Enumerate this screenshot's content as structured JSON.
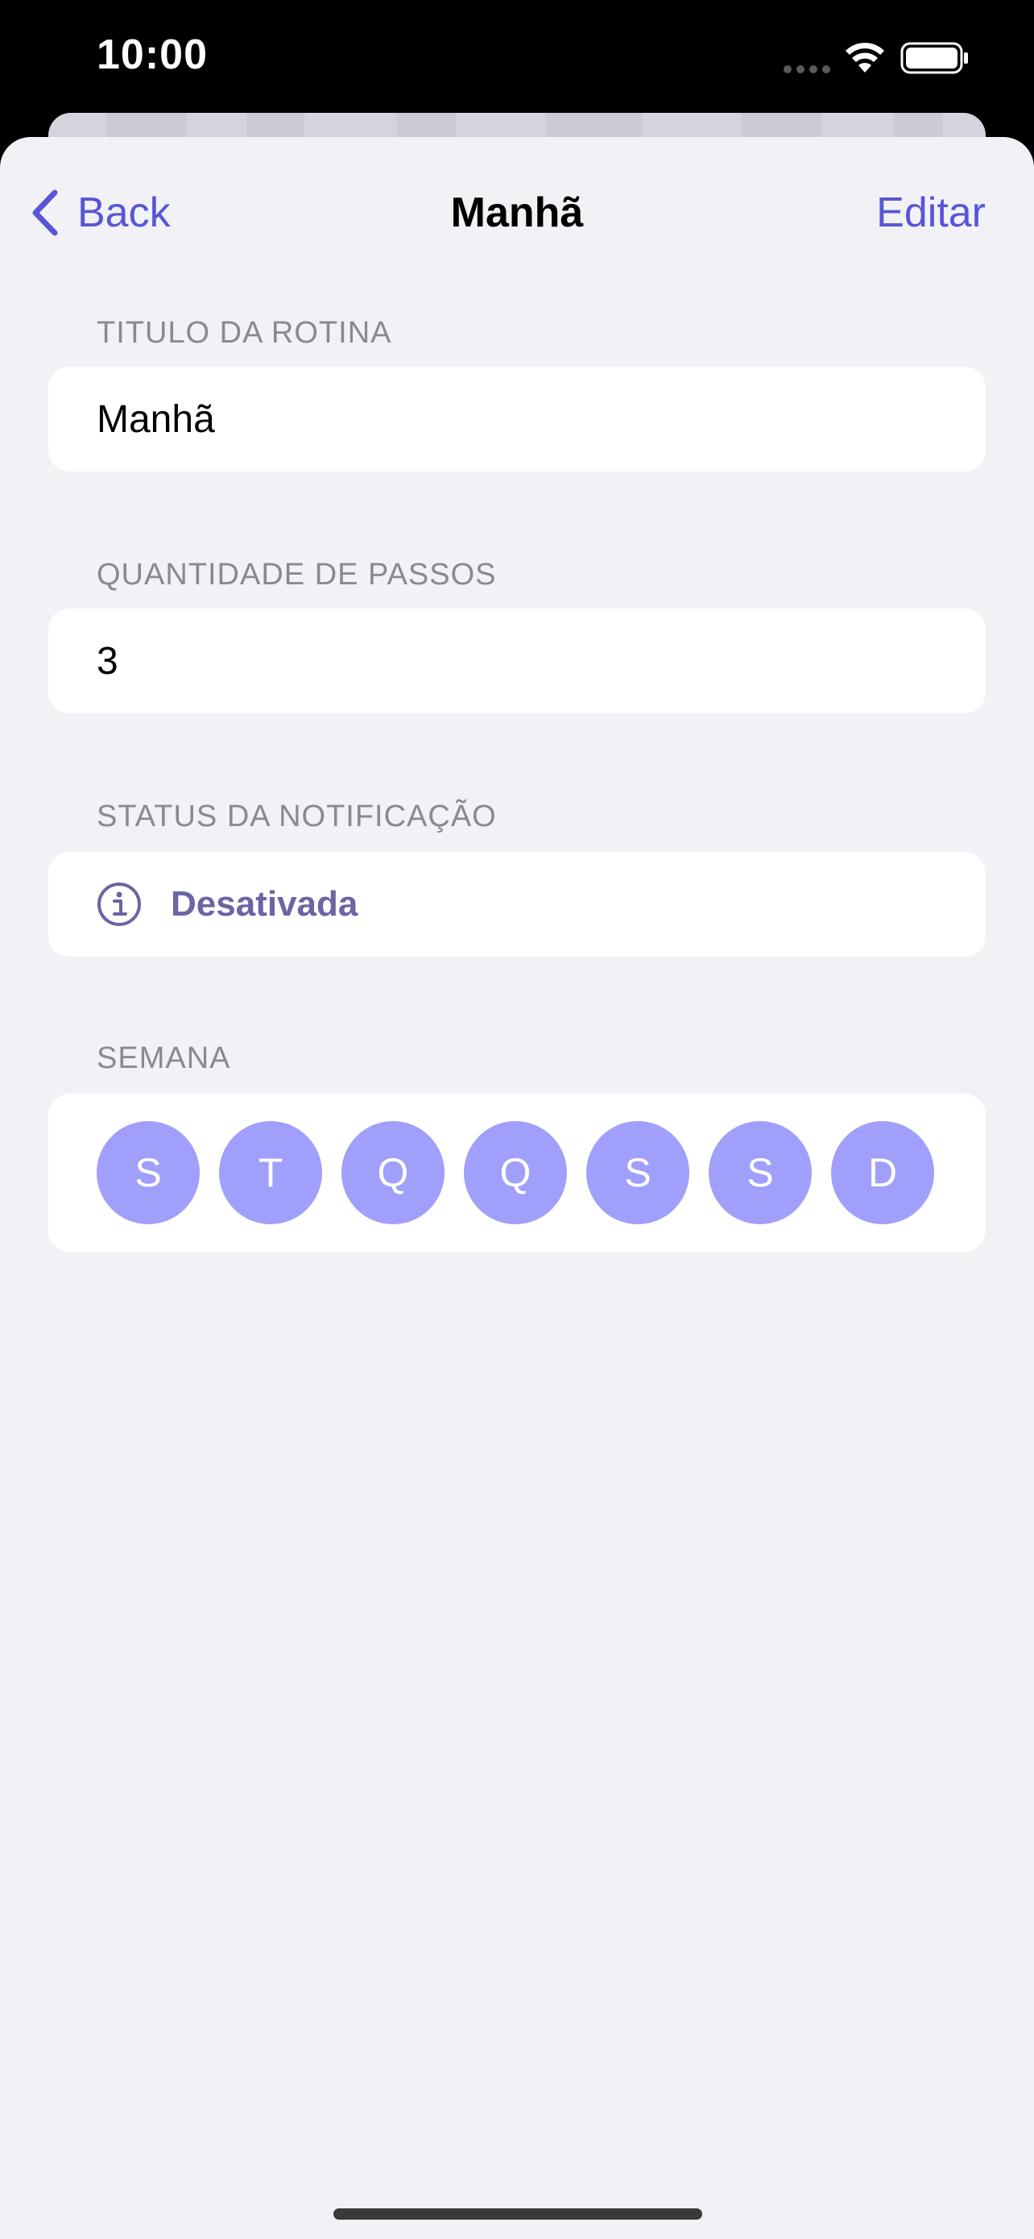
{
  "status_bar": {
    "time": "10:00",
    "icons": [
      "cellular-signal-icon",
      "wifi-icon",
      "battery-icon"
    ]
  },
  "nav": {
    "back_label": "Back",
    "title": "Manhã",
    "edit_label": "Editar",
    "back_icon": "chevron-left-icon"
  },
  "sections": {
    "title": {
      "header": "TITULO DA ROTINA",
      "value": "Manhã"
    },
    "steps": {
      "header": "QUANTIDADE DE PASSOS",
      "value": "3"
    },
    "notification": {
      "header": "STATUS DA NOTIFICAÇÃO",
      "value": "Desativada",
      "icon": "info-icon"
    },
    "week": {
      "header": "SEMANA",
      "days": [
        "S",
        "T",
        "Q",
        "Q",
        "S",
        "S",
        "D"
      ]
    }
  },
  "colors": {
    "accent": "#5856d6",
    "day_circle": "#a09ffc",
    "status_text": "#6a65a3",
    "background": "#f1f1f6",
    "section_header": "#8a8a8e"
  }
}
